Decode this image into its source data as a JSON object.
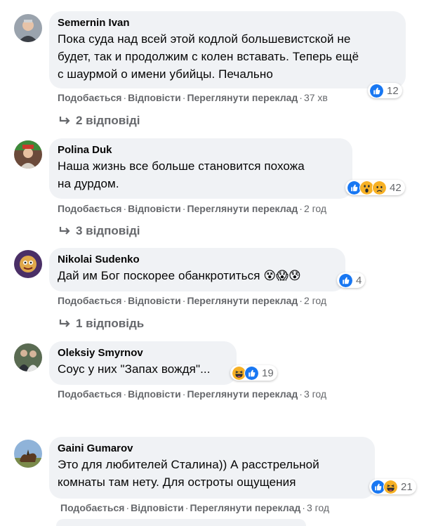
{
  "comments": [
    {
      "author": "Semernin Ivan",
      "lines": [
        "Пока суда над всей этой кодлой большевистской не",
        "будет, так и продолжим с колен вставать. Теперь ещё",
        "с шаурмой о имени убийцы. Печально"
      ],
      "reactions": [
        "like-icon"
      ],
      "reaction_count": "12",
      "actions": {
        "like": "Подобається",
        "reply": "Відповісти",
        "translate": "Переглянути переклад",
        "time": "37 хв"
      },
      "replies": "2 відповіді"
    },
    {
      "author": "Polina Duk",
      "lines": [
        "Наша жизнь все больше становится похожа",
        "на дурдом."
      ],
      "reactions": [
        "like-icon",
        "wow-icon",
        "sad-icon"
      ],
      "reaction_count": "42",
      "actions": {
        "like": "Подобається",
        "reply": "Відповісти",
        "translate": "Переглянути переклад",
        "time": "2 год"
      },
      "replies": "3 відповіді"
    },
    {
      "author": "Nikolai Sudenko",
      "lines": [
        "Дай им Бог поскорее обанкротиться 😵😱😰"
      ],
      "reactions": [
        "like-icon"
      ],
      "reaction_count": "4",
      "actions": {
        "like": "Подобається",
        "reply": "Відповісти",
        "translate": "Переглянути переклад",
        "time": "2 год"
      },
      "replies": "1 відповідь"
    },
    {
      "author": "Oleksiy Smyrnov",
      "lines": [
        "Соус у них \"Запах вождя\"..."
      ],
      "reactions": [
        "haha-icon",
        "like-icon"
      ],
      "reaction_count": "19",
      "actions": {
        "like": "Подобається",
        "reply": "Відповісти",
        "translate": "Переглянути переклад",
        "time": "3 год"
      }
    },
    {
      "author": "Gaini Gumarov",
      "lines": [
        "Это для любителей Сталина)) А расстрельной",
        "комнаты там нету. Для остроты ощущения"
      ],
      "reactions": [
        "like-icon",
        "haha-icon"
      ],
      "reaction_count": "21",
      "actions": {
        "like": "Подобається",
        "reply": "Відповісти",
        "translate": "Переглянути переклад",
        "time": "3 год"
      }
    }
  ],
  "colors": {
    "bubble": "#f0f2f5",
    "meta": "#65676b",
    "like_blue": "#1877f2",
    "emoji_yellow": "#f7b125"
  }
}
